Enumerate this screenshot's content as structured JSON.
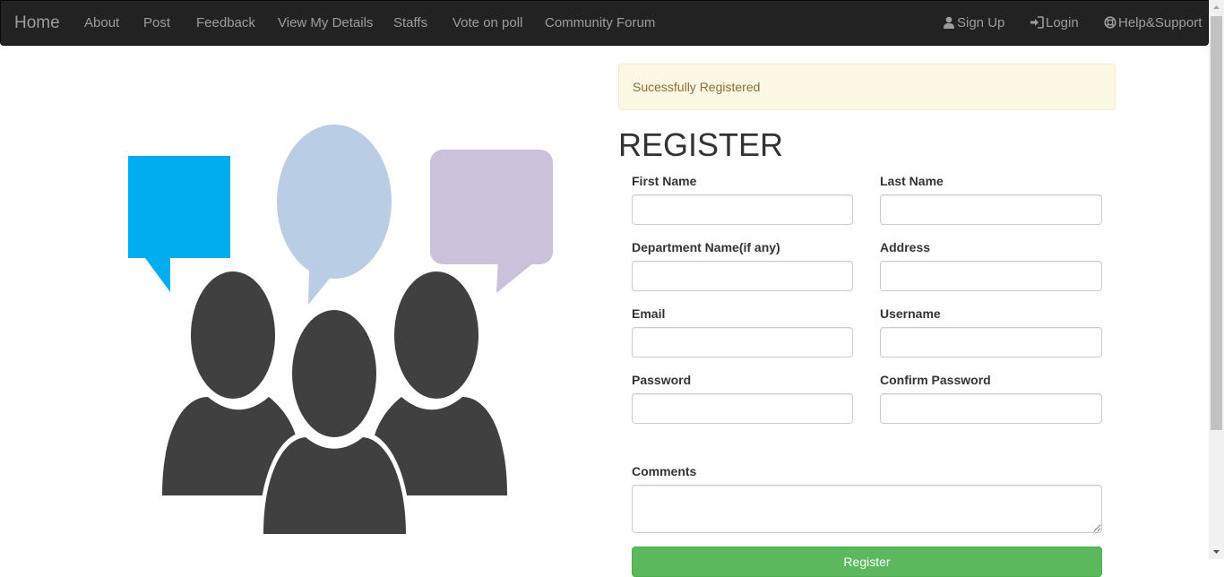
{
  "nav": {
    "brand": "Home",
    "items": [
      "About",
      "Post",
      "Feedback",
      "View My Details",
      "Staffs",
      "Vote on poll",
      "Community Forum"
    ],
    "signup": "Sign Up",
    "login": "Login",
    "help": "Help&Support"
  },
  "alert": {
    "message": "Sucessfully Registered"
  },
  "form": {
    "title": "REGISTER",
    "first_name": "First Name",
    "last_name": "Last Name",
    "department": "Department Name(if any)",
    "address": "Address",
    "email": "Email",
    "username": "Username",
    "password": "Password",
    "confirm_password": "Confirm Password",
    "comments": "Comments",
    "submit": "Register"
  },
  "colors": {
    "navbar": "#222222",
    "alert_bg": "#fcf8e3",
    "alert_text": "#8a6d3b",
    "button": "#5cb85c",
    "bubble_blue": "#00aeef",
    "bubble_light": "#b9cde5",
    "bubble_purple": "#ccc1da",
    "people": "#404040"
  },
  "icons": [
    "user-icon",
    "login-icon",
    "lifebuoy-icon",
    "community-illustration"
  ]
}
